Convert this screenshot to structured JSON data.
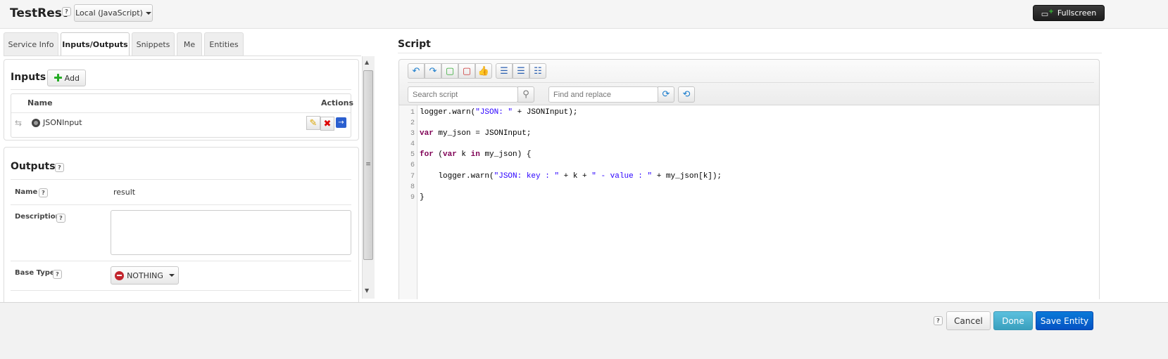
{
  "header": {
    "title": "TestRest",
    "help": "?",
    "engine": "Local (JavaScript)",
    "fullscreen": "Fullscreen"
  },
  "tabs": [
    {
      "label": "Service Info"
    },
    {
      "label": "Inputs/Outputs",
      "active": true
    },
    {
      "label": "Snippets"
    },
    {
      "label": "Me"
    },
    {
      "label": "Entities"
    }
  ],
  "inputs": {
    "title": "Inputs",
    "add": "Add",
    "columns": [
      "Name",
      "Actions"
    ],
    "rows": [
      {
        "name": "JSONInput"
      }
    ]
  },
  "outputs": {
    "title": "Outputs",
    "help": "?",
    "name_label": "Name",
    "name_value": "result",
    "description_label": "Description",
    "description_value": "",
    "base_type_label": "Base Type",
    "base_type_value": "NOTHING"
  },
  "script": {
    "title": "Script",
    "search_placeholder": "Search script",
    "replace_placeholder": "Find and replace",
    "lines": [
      "1",
      "2",
      "3",
      "4",
      "5",
      "6",
      "7",
      "8",
      "9"
    ]
  },
  "footer": {
    "help": "?",
    "cancel": "Cancel",
    "done": "Done",
    "save": "Save Entity"
  },
  "colors": {
    "done": "#4fb0cf",
    "save": "#0a63cf",
    "keyword": "#7f0055",
    "string": "#2a00ff"
  }
}
